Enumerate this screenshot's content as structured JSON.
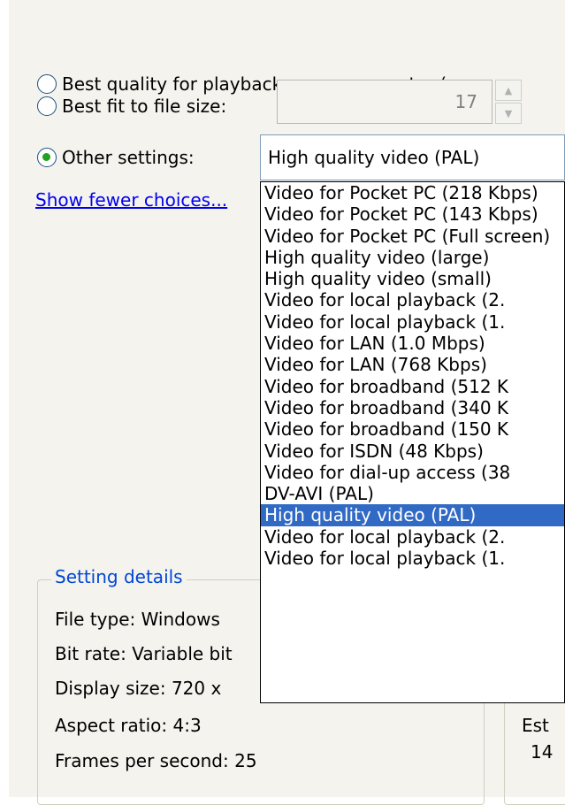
{
  "options": {
    "best_quality": "Best quality for playback on my computer (rec",
    "best_fit": "Best fit to file size:",
    "other": "Other settings:"
  },
  "file_size": {
    "value": "17"
  },
  "combo": {
    "selected": "High quality video (PAL)"
  },
  "show_fewer": "Show fewer choices...",
  "dropdown": {
    "items": [
      "Video for Pocket PC (218 Kbps)",
      "Video for Pocket PC (143 Kbps)",
      "Video for Pocket PC (Full screen)",
      "High quality video (large)",
      "High quality video (small)",
      "Video for local playback (2.",
      "Video for local playback (1.",
      "Video for LAN (1.0 Mbps)",
      "Video for LAN (768 Kbps)",
      "Video for broadband (512 K",
      "Video for broadband (340 K",
      "Video for broadband (150 K",
      "Video for ISDN (48 Kbps)",
      "Video for dial-up access (38",
      "DV-AVI (PAL)",
      "High quality video (PAL)",
      "Video for local playback (2.",
      "Video for local playback (1."
    ],
    "selected_index": 15
  },
  "details": {
    "title": "Setting details",
    "file_type": "File type: Windows",
    "bit_rate": "Bit rate: Variable bit",
    "display_size": "Display size: 720 x",
    "aspect_ratio": "Aspect ratio: 4:3",
    "fps": "Frames per second: 25"
  },
  "estimate": {
    "label": "Est",
    "value": "14"
  }
}
